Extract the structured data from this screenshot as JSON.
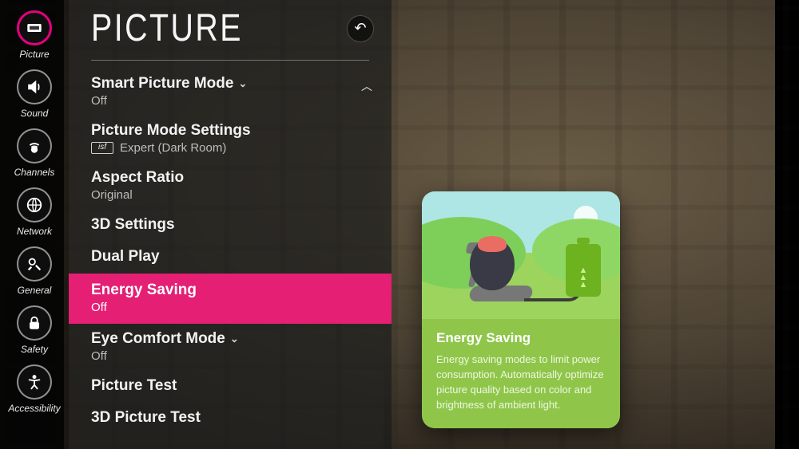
{
  "header": {
    "title": "PICTURE"
  },
  "sidebar": {
    "items": [
      {
        "label": "Picture",
        "icon": "picture-icon",
        "selected": true
      },
      {
        "label": "Sound",
        "icon": "sound-icon",
        "selected": false
      },
      {
        "label": "Channels",
        "icon": "channels-icon",
        "selected": false
      },
      {
        "label": "Network",
        "icon": "network-icon",
        "selected": false
      },
      {
        "label": "General",
        "icon": "general-icon",
        "selected": false
      },
      {
        "label": "Safety",
        "icon": "safety-icon",
        "selected": false
      },
      {
        "label": "Accessibility",
        "icon": "accessibility-icon",
        "selected": false
      }
    ]
  },
  "menu": {
    "smart_picture_mode": {
      "title": "Smart Picture Mode",
      "value": "Off",
      "has_dropdown": true
    },
    "picture_mode_settings": {
      "title": "Picture Mode Settings",
      "badge": "isf",
      "value": "Expert (Dark Room)"
    },
    "aspect_ratio": {
      "title": "Aspect Ratio",
      "value": "Original"
    },
    "three_d_settings": {
      "title": "3D Settings"
    },
    "dual_play": {
      "title": "Dual Play"
    },
    "energy_saving": {
      "title": "Energy Saving",
      "value": "Off",
      "highlighted": true
    },
    "eye_comfort_mode": {
      "title": "Eye Comfort Mode",
      "value": "Off",
      "has_dropdown": true
    },
    "picture_test": {
      "title": "Picture Test"
    },
    "three_d_picture_test": {
      "title": "3D Picture Test"
    }
  },
  "tooltip": {
    "title": "Energy Saving",
    "body": "Energy saving modes to limit power consumption.\nAutomatically optimize picture quality based on color and brightness of ambient light."
  },
  "colors": {
    "accent": "#e6007e",
    "highlight": "#e41f74",
    "tooltip_green": "#8fc64a"
  }
}
